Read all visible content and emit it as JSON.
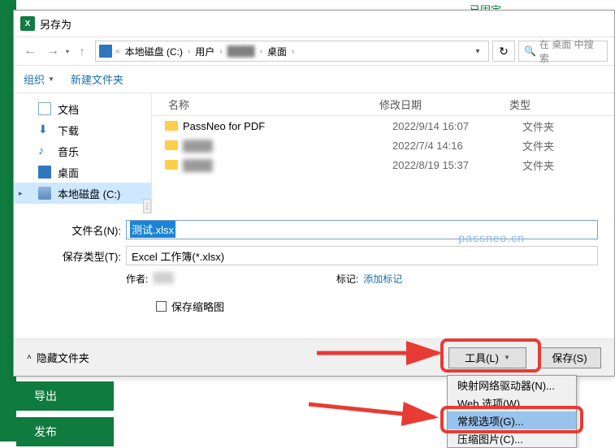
{
  "pinned_label": "已固定",
  "dialog": {
    "title": "另存为",
    "breadcrumb": {
      "sep": "«",
      "parts": [
        "本地磁盘 (C:)",
        "用户",
        "",
        "桌面"
      ]
    },
    "search_placeholder": "在 桌面 中搜索",
    "toolbar": {
      "organize": "组织",
      "new_folder": "新建文件夹"
    },
    "sidebar": {
      "items": [
        {
          "label": "文档"
        },
        {
          "label": "下载"
        },
        {
          "label": "音乐"
        },
        {
          "label": "桌面"
        },
        {
          "label": "本地磁盘 (C:)"
        }
      ]
    },
    "list": {
      "headers": {
        "name": "名称",
        "date": "修改日期",
        "type": "类型"
      },
      "rows": [
        {
          "name": "PassNeo for PDF",
          "date": "2022/9/14 16:07",
          "type": "文件夹"
        },
        {
          "name": "",
          "date": "2022/7/4 14:16",
          "type": "文件夹"
        },
        {
          "name": "",
          "date": "2022/8/19 15:37",
          "type": "文件夹"
        }
      ]
    },
    "form": {
      "filename_label": "文件名(N):",
      "filename_value": "测试.xlsx",
      "filetype_label": "保存类型(T):",
      "filetype_value": "Excel 工作簿(*.xlsx)",
      "author_label": "作者:",
      "author_value": "",
      "tags_label": "标记:",
      "tags_value": "添加标记",
      "save_thumbnail": "保存缩略图"
    },
    "footer": {
      "hide_folders": "隐藏文件夹",
      "tools": "工具(L)",
      "save": "保存(S)"
    },
    "tools_menu": [
      "映射网络驱动器(N)...",
      "Web 选项(W)...",
      "常规选项(G)...",
      "压缩图片(C)..."
    ],
    "watermark": "passneo.cn"
  },
  "side_nav": {
    "export": "导出",
    "publish": "发布"
  }
}
